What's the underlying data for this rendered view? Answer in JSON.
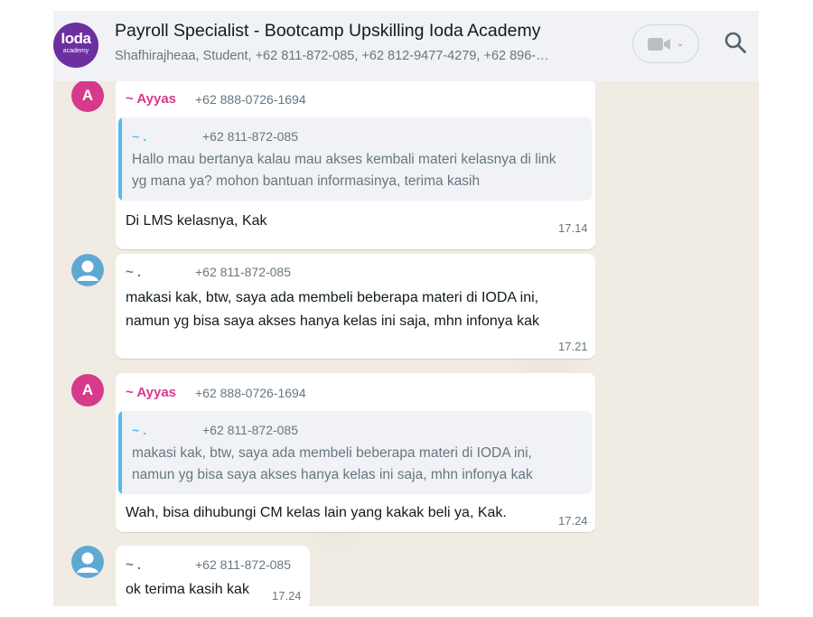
{
  "header": {
    "group_logo_main": "Ioda",
    "group_logo_sub": "academy",
    "title": "Payroll Specialist - Bootcamp Upskilling Ioda Academy",
    "members": "Shafhirajheaa, Student, +62 811-872-085, +62 812-9477-4279, +62 896-…",
    "video_chevron": "⌄"
  },
  "messages": [
    {
      "avatar": "A",
      "sender": "~ Ayyas",
      "phone": "+62 888-0726-1694",
      "quote": {
        "name": "~ .",
        "phone": "+62 811-872-085",
        "line1": "Hallo mau bertanya kalau mau akses kembali materi kelasnya di link",
        "line2": "yg mana ya? mohon bantuan informasinya, terima kasih"
      },
      "text": "Di LMS kelasnya, Kak",
      "time": "17.14"
    },
    {
      "sender": "~ .",
      "phone": "+62 811-872-085",
      "line1": "makasi kak, btw, saya ada membeli beberapa materi di IODA ini,",
      "line2": "namun yg bisa saya akses hanya kelas ini saja, mhn infonya kak",
      "time": "17.21"
    },
    {
      "avatar": "A",
      "sender": "~ Ayyas",
      "phone": "+62 888-0726-1694",
      "quote": {
        "name": "~ .",
        "phone": "+62 811-872-085",
        "line1": "makasi kak, btw, saya ada membeli beberapa materi di IODA ini,",
        "line2": "namun yg bisa saya akses hanya kelas ini saja, mhn infonya kak"
      },
      "text": "Wah, bisa dihubungi CM kelas lain yang kakak beli ya, Kak.",
      "time": "17.24"
    },
    {
      "sender": "~ .",
      "phone": "+62 811-872-085",
      "text": "ok terima kasih kak",
      "time": "17.24"
    }
  ]
}
